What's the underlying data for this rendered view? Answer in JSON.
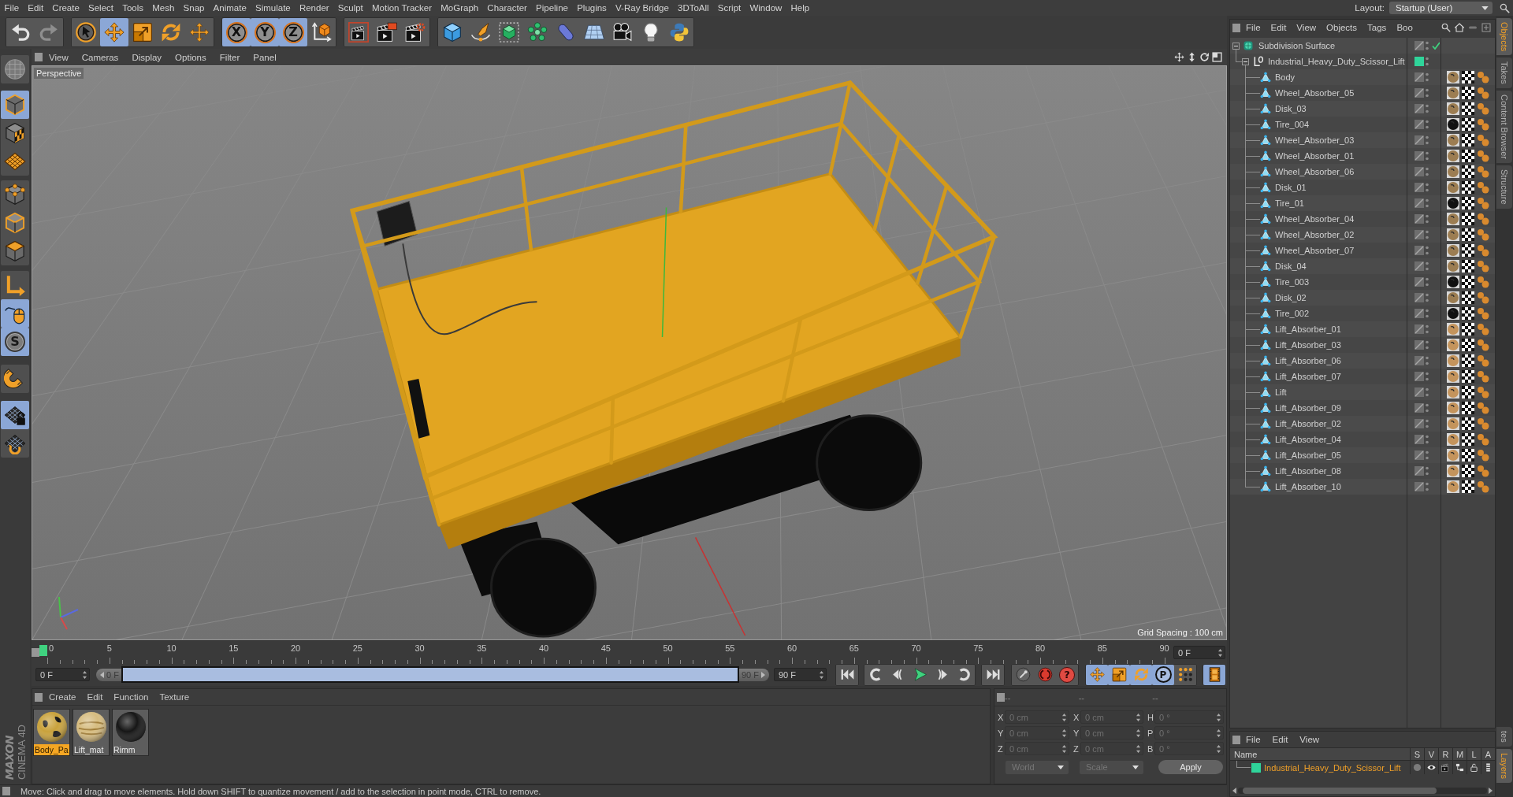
{
  "menu_bar": {
    "items": [
      "File",
      "Edit",
      "Create",
      "Select",
      "Tools",
      "Mesh",
      "Snap",
      "Animate",
      "Simulate",
      "Render",
      "Sculpt",
      "Motion Tracker",
      "MoGraph",
      "Character",
      "Pipeline",
      "Plugins",
      "V-Ray Bridge",
      "3DToAll",
      "Script",
      "Window",
      "Help"
    ],
    "layout_label": "Layout:",
    "layout_value": "Startup (User)"
  },
  "toolbar": [
    [
      {
        "kind": "undo",
        "disabled": false
      },
      {
        "kind": "redo",
        "disabled": true
      }
    ],
    [
      {
        "kind": "live-select",
        "selected": false
      },
      {
        "kind": "move",
        "selected": true
      },
      {
        "kind": "scale",
        "selected": false
      },
      {
        "kind": "rotate",
        "selected": false
      },
      {
        "kind": "transform",
        "selected": false
      }
    ],
    [
      {
        "kind": "axis-lock",
        "label": "X",
        "selected": true
      },
      {
        "kind": "axis-lock",
        "label": "Y",
        "selected": true
      },
      {
        "kind": "axis-lock",
        "label": "Z",
        "selected": true
      },
      {
        "kind": "coordinate-system",
        "selected": false
      }
    ],
    [
      {
        "kind": "render-view"
      },
      {
        "kind": "render-to-viewer"
      },
      {
        "kind": "render-settings"
      }
    ],
    [
      {
        "kind": "cube"
      },
      {
        "kind": "pen"
      },
      {
        "kind": "subdivision"
      },
      {
        "kind": "cloner"
      },
      {
        "kind": "deformer"
      },
      {
        "kind": "floor"
      },
      {
        "kind": "camera"
      },
      {
        "kind": "light"
      },
      {
        "kind": "script"
      }
    ]
  ],
  "left_toolbar": [
    [
      {
        "kind": "sculpt"
      }
    ],
    [
      {
        "kind": "model",
        "selected": true
      },
      {
        "kind": "texture",
        "selected": false
      },
      {
        "kind": "workplane",
        "selected": false
      }
    ],
    [
      {
        "kind": "points",
        "selected": false
      },
      {
        "kind": "edges",
        "selected": false
      },
      {
        "kind": "polygons",
        "selected": false
      }
    ],
    [
      {
        "kind": "axis",
        "selected": false
      },
      {
        "kind": "tweak",
        "selected": true
      },
      {
        "kind": "snap",
        "label": "S",
        "selected": true
      }
    ],
    [
      {
        "kind": "magnet"
      }
    ],
    [
      {
        "kind": "workplane-lock",
        "selected": true
      },
      {
        "kind": "workplane-rotate",
        "selected": false
      }
    ]
  ],
  "viewport": {
    "menu": [
      "View",
      "Cameras",
      "Display",
      "Options",
      "Filter",
      "Panel"
    ],
    "camera": "Perspective",
    "grid_spacing": "Grid Spacing : 100 cm"
  },
  "timeline": {
    "ticks": [
      "0",
      "5",
      "10",
      "15",
      "20",
      "25",
      "30",
      "35",
      "40",
      "45",
      "50",
      "55",
      "60",
      "65",
      "70",
      "75",
      "80",
      "85",
      "90"
    ],
    "current_frame": "0 F"
  },
  "frame_range": {
    "start": "0 F",
    "slider_start": "0 F",
    "slider_end": "90 F",
    "end": "90 F"
  },
  "playback": {
    "transport": [
      [
        {
          "kind": "go-start"
        }
      ],
      [
        {
          "kind": "previous-key"
        },
        {
          "kind": "previous-frame"
        },
        {
          "kind": "play"
        },
        {
          "kind": "next-frame"
        },
        {
          "kind": "next-key"
        }
      ],
      [
        {
          "kind": "go-end"
        }
      ]
    ],
    "keys": [
      {
        "kind": "record",
        "disabled": true
      },
      {
        "kind": "autokey",
        "disabled": false
      },
      {
        "kind": "key-selection",
        "label": "?",
        "disabled": false
      }
    ],
    "tracks": [
      {
        "kind": "move",
        "selected": true
      },
      {
        "kind": "scale",
        "selected": true
      },
      {
        "kind": "rotate",
        "selected": true
      },
      {
        "kind": "parameter",
        "label": "P",
        "selected": true
      },
      {
        "kind": "point-level",
        "selected": false
      }
    ],
    "timeline_button": {
      "kind": "timeline",
      "selected": true
    }
  },
  "material_manager": {
    "menu": [
      "Create",
      "Edit",
      "Function",
      "Texture"
    ],
    "materials": [
      {
        "name": "Body_Pa",
        "kind": "patches",
        "color": "#c9a23c",
        "selected": true
      },
      {
        "name": "Lift_mat",
        "kind": "streaks",
        "color": "#d6bc80",
        "selected": false
      },
      {
        "name": "Rimm",
        "kind": "plain",
        "color": "#161616",
        "selected": false
      }
    ]
  },
  "coordinates": {
    "headers": [
      "--",
      "--",
      "--"
    ],
    "rows": [
      [
        {
          "axis": "X",
          "value": "0 cm"
        },
        {
          "axis": "X",
          "value": "0 cm"
        },
        {
          "axis": "H",
          "value": "0 °"
        }
      ],
      [
        {
          "axis": "Y",
          "value": "0 cm"
        },
        {
          "axis": "Y",
          "value": "0 cm"
        },
        {
          "axis": "P",
          "value": "0 °"
        }
      ],
      [
        {
          "axis": "Z",
          "value": "0 cm"
        },
        {
          "axis": "Z",
          "value": "0 cm"
        },
        {
          "axis": "B",
          "value": "0 °"
        }
      ]
    ],
    "disabled": true,
    "space": "World",
    "mode": "Scale",
    "apply": "Apply"
  },
  "logo": {
    "brand": "MAXON",
    "product": "CINEMA 4D"
  },
  "status_bar": {
    "text": "Move: Click and drag to move elements. Hold down SHIFT to quantize movement / add to the selection in point mode, CTRL to remove."
  },
  "object_manager": {
    "menu": [
      "File",
      "Edit",
      "View",
      "Objects",
      "Tags",
      "Boo"
    ],
    "tree": [
      {
        "name": "Subdivision Surface",
        "kind": "subdivision",
        "enabled": true,
        "expanded": true,
        "children": [
          {
            "name": "Industrial_Heavy_Duty_Scissor_Lift",
            "kind": "null",
            "color": "#2fd49a",
            "expanded": true,
            "children": [
              {
                "name": "Body",
                "kind": "polygon",
                "tags": [
                  {
                    "kind": "material",
                    "color": "#9c7d52"
                  },
                  {
                    "kind": "uvw"
                  },
                  {
                    "kind": "phong"
                  }
                ]
              },
              {
                "name": "Wheel_Absorber_05",
                "kind": "polygon",
                "tags": [
                  {
                    "kind": "material",
                    "color": "#9c7d52"
                  },
                  {
                    "kind": "uvw"
                  },
                  {
                    "kind": "phong"
                  }
                ]
              },
              {
                "name": "Disk_03",
                "kind": "polygon",
                "tags": [
                  {
                    "kind": "material",
                    "color": "#9c7d52"
                  },
                  {
                    "kind": "uvw"
                  },
                  {
                    "kind": "phong"
                  }
                ]
              },
              {
                "name": "Tire_004",
                "kind": "polygon",
                "tags": [
                  {
                    "kind": "material",
                    "color": "#111111"
                  },
                  {
                    "kind": "uvw"
                  },
                  {
                    "kind": "phong"
                  }
                ]
              },
              {
                "name": "Wheel_Absorber_03",
                "kind": "polygon",
                "tags": [
                  {
                    "kind": "material",
                    "color": "#9c7d52"
                  },
                  {
                    "kind": "uvw"
                  },
                  {
                    "kind": "phong"
                  }
                ]
              },
              {
                "name": "Wheel_Absorber_01",
                "kind": "polygon",
                "tags": [
                  {
                    "kind": "material",
                    "color": "#9c7d52"
                  },
                  {
                    "kind": "uvw"
                  },
                  {
                    "kind": "phong"
                  }
                ]
              },
              {
                "name": "Wheel_Absorber_06",
                "kind": "polygon",
                "tags": [
                  {
                    "kind": "material",
                    "color": "#9c7d52"
                  },
                  {
                    "kind": "uvw"
                  },
                  {
                    "kind": "phong"
                  }
                ]
              },
              {
                "name": "Disk_01",
                "kind": "polygon",
                "tags": [
                  {
                    "kind": "material",
                    "color": "#9c7d52"
                  },
                  {
                    "kind": "uvw"
                  },
                  {
                    "kind": "phong"
                  }
                ]
              },
              {
                "name": "Tire_01",
                "kind": "polygon",
                "tags": [
                  {
                    "kind": "material",
                    "color": "#111111"
                  },
                  {
                    "kind": "uvw"
                  },
                  {
                    "kind": "phong"
                  }
                ]
              },
              {
                "name": "Wheel_Absorber_04",
                "kind": "polygon",
                "tags": [
                  {
                    "kind": "material",
                    "color": "#9c7d52"
                  },
                  {
                    "kind": "uvw"
                  },
                  {
                    "kind": "phong"
                  }
                ]
              },
              {
                "name": "Wheel_Absorber_02",
                "kind": "polygon",
                "tags": [
                  {
                    "kind": "material",
                    "color": "#9c7d52"
                  },
                  {
                    "kind": "uvw"
                  },
                  {
                    "kind": "phong"
                  }
                ]
              },
              {
                "name": "Wheel_Absorber_07",
                "kind": "polygon",
                "tags": [
                  {
                    "kind": "material",
                    "color": "#9c7d52"
                  },
                  {
                    "kind": "uvw"
                  },
                  {
                    "kind": "phong"
                  }
                ]
              },
              {
                "name": "Disk_04",
                "kind": "polygon",
                "tags": [
                  {
                    "kind": "material",
                    "color": "#9c7d52"
                  },
                  {
                    "kind": "uvw"
                  },
                  {
                    "kind": "phong"
                  }
                ]
              },
              {
                "name": "Tire_003",
                "kind": "polygon",
                "tags": [
                  {
                    "kind": "material",
                    "color": "#111111"
                  },
                  {
                    "kind": "uvw"
                  },
                  {
                    "kind": "phong"
                  }
                ]
              },
              {
                "name": "Disk_02",
                "kind": "polygon",
                "tags": [
                  {
                    "kind": "material",
                    "color": "#9c7d52"
                  },
                  {
                    "kind": "uvw"
                  },
                  {
                    "kind": "phong"
                  }
                ]
              },
              {
                "name": "Tire_002",
                "kind": "polygon",
                "tags": [
                  {
                    "kind": "material",
                    "color": "#111111"
                  },
                  {
                    "kind": "uvw"
                  },
                  {
                    "kind": "phong"
                  }
                ]
              },
              {
                "name": "Lift_Absorber_01",
                "kind": "polygon",
                "tags": [
                  {
                    "kind": "material",
                    "color": "#c4945c"
                  },
                  {
                    "kind": "uvw"
                  },
                  {
                    "kind": "phong"
                  }
                ]
              },
              {
                "name": "Lift_Absorber_03",
                "kind": "polygon",
                "tags": [
                  {
                    "kind": "material",
                    "color": "#c4945c"
                  },
                  {
                    "kind": "uvw"
                  },
                  {
                    "kind": "phong"
                  }
                ]
              },
              {
                "name": "Lift_Absorber_06",
                "kind": "polygon",
                "tags": [
                  {
                    "kind": "material",
                    "color": "#c4945c"
                  },
                  {
                    "kind": "uvw"
                  },
                  {
                    "kind": "phong"
                  }
                ]
              },
              {
                "name": "Lift_Absorber_07",
                "kind": "polygon",
                "tags": [
                  {
                    "kind": "material",
                    "color": "#c4945c"
                  },
                  {
                    "kind": "uvw"
                  },
                  {
                    "kind": "phong"
                  }
                ]
              },
              {
                "name": "Lift",
                "kind": "polygon",
                "tags": [
                  {
                    "kind": "material",
                    "color": "#c4945c"
                  },
                  {
                    "kind": "uvw"
                  },
                  {
                    "kind": "phong"
                  }
                ]
              },
              {
                "name": "Lift_Absorber_09",
                "kind": "polygon",
                "tags": [
                  {
                    "kind": "material",
                    "color": "#c4945c"
                  },
                  {
                    "kind": "uvw"
                  },
                  {
                    "kind": "phong"
                  }
                ]
              },
              {
                "name": "Lift_Absorber_02",
                "kind": "polygon",
                "tags": [
                  {
                    "kind": "material",
                    "color": "#c4945c"
                  },
                  {
                    "kind": "uvw"
                  },
                  {
                    "kind": "phong"
                  }
                ]
              },
              {
                "name": "Lift_Absorber_04",
                "kind": "polygon",
                "tags": [
                  {
                    "kind": "material",
                    "color": "#c4945c"
                  },
                  {
                    "kind": "uvw"
                  },
                  {
                    "kind": "phong"
                  }
                ]
              },
              {
                "name": "Lift_Absorber_05",
                "kind": "polygon",
                "tags": [
                  {
                    "kind": "material",
                    "color": "#c4945c"
                  },
                  {
                    "kind": "uvw"
                  },
                  {
                    "kind": "phong"
                  }
                ]
              },
              {
                "name": "Lift_Absorber_08",
                "kind": "polygon",
                "tags": [
                  {
                    "kind": "material",
                    "color": "#c4945c"
                  },
                  {
                    "kind": "uvw"
                  },
                  {
                    "kind": "phong"
                  }
                ]
              },
              {
                "name": "Lift_Absorber_10",
                "kind": "polygon",
                "tags": [
                  {
                    "kind": "material",
                    "color": "#c4945c"
                  },
                  {
                    "kind": "uvw"
                  },
                  {
                    "kind": "phong"
                  }
                ]
              }
            ]
          }
        ]
      }
    ]
  },
  "layer_manager": {
    "menu": [
      "File",
      "Edit",
      "View"
    ],
    "columns": [
      "Name",
      "S",
      "V",
      "R",
      "M",
      "L",
      "A"
    ],
    "layers": [
      {
        "name": "Industrial_Heavy_Duty_Scissor_Lift",
        "color": "#2fd49a"
      }
    ]
  },
  "side_tabs": {
    "upper": [
      {
        "label": "Objects",
        "selected": true
      },
      {
        "label": "Takes",
        "selected": false
      },
      {
        "label": "Content Browser",
        "selected": false
      },
      {
        "label": "Structure",
        "selected": false
      }
    ],
    "lower": [
      {
        "label": "tes",
        "selected": false
      },
      {
        "label": "Layers",
        "selected": true
      }
    ]
  }
}
